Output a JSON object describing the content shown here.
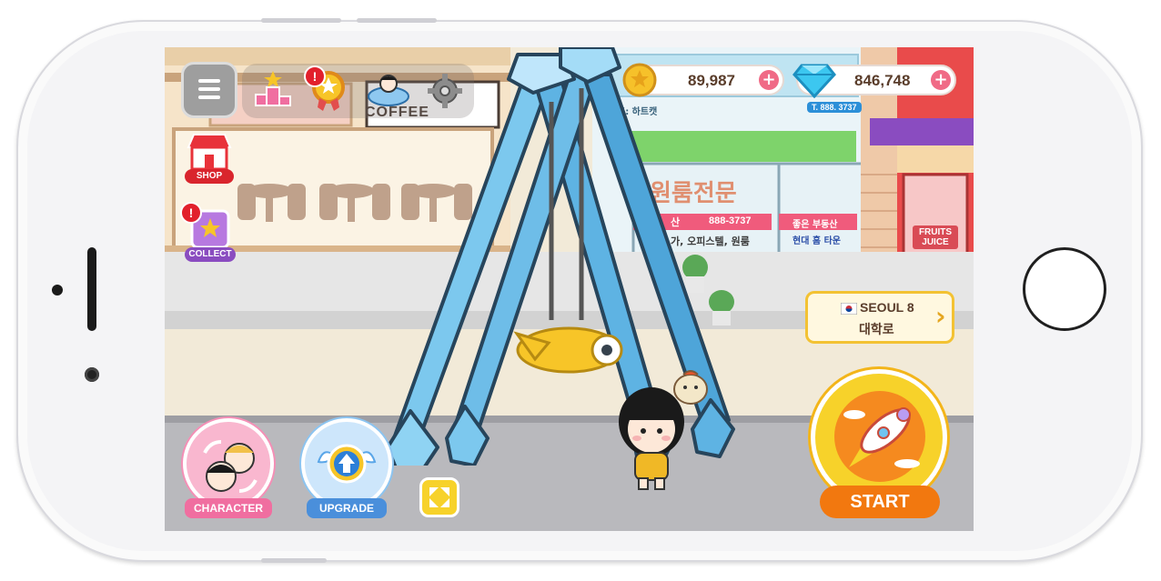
{
  "hud": {
    "coins": "89,987",
    "gems": "846,748",
    "plus_symbol": "+"
  },
  "left_menu": {
    "shop_label": "SHOP",
    "collect_label": "COLLECT",
    "alert_mark": "!"
  },
  "bottom_buttons": {
    "character_label": "CHARACTER",
    "upgrade_label": "UPGRADE",
    "start_label": "START"
  },
  "location": {
    "city": "SEOUL 8",
    "district": "대학로",
    "chevron": "›"
  },
  "background_signs": {
    "cafe_sign": "COFFEE",
    "store_headline": "원룸전문",
    "store_phone": "888-3737",
    "store_sub": "가, 오피스텔, 원룸",
    "realty_name": "좋은 부동산",
    "realty_sub": "현대 홈 타운",
    "phone_top": "T. 888. 3737",
    "heart_label": "표: 하트캣",
    "juice_sign_line1": "FRUITS",
    "juice_sign_line2": "JUICE",
    "store_left_cut": "산"
  },
  "colors": {
    "coin_gold": "#f6c12a",
    "gem_blue": "#3cc7f0",
    "character_pink": "#f48fb6",
    "upgrade_blue": "#5aa6e8",
    "start_orange": "#f58a1f"
  }
}
